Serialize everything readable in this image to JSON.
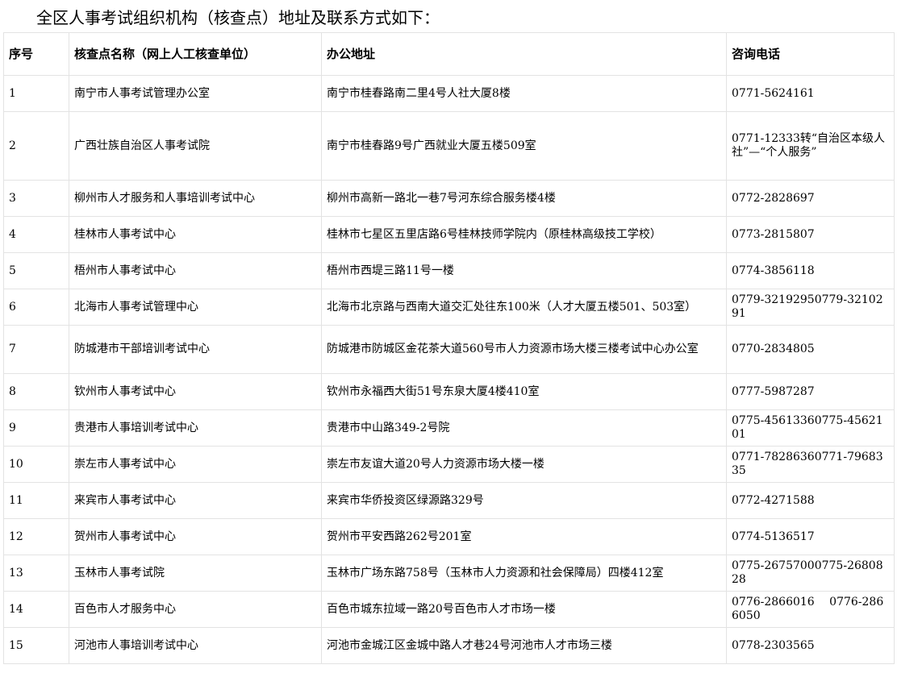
{
  "heading": "全区人事考试组织机构（核查点）地址及联系方式如下：",
  "table": {
    "headers": [
      "序号",
      "核查点名称（网上人工核查单位）",
      "办公地址",
      "咨询电话"
    ],
    "rows": [
      {
        "no": "1",
        "name": "南宁市人事考试管理办公室",
        "address": "南宁市桂春路南二里4号人社大厦8楼",
        "phone": "0771-5624161"
      },
      {
        "no": "2",
        "name": "广西壮族自治区人事考试院",
        "address": "南宁市桂春路9号广西就业大厦五楼509室",
        "phone": "0771-12333转“自治区本级人社”—“个人服务”"
      },
      {
        "no": "3",
        "name": "柳州市人才服务和人事培训考试中心",
        "address": "柳州市高新一路北一巷7号河东综合服务楼4楼",
        "phone": "0772-2828697"
      },
      {
        "no": "4",
        "name": "桂林市人事考试中心",
        "address": "桂林市七星区五里店路6号桂林技师学院内（原桂林高级技工学校）",
        "phone": "0773-2815807"
      },
      {
        "no": "5",
        "name": "梧州市人事考试中心",
        "address": "梧州市西堤三路11号一楼",
        "phone": "0774-3856118"
      },
      {
        "no": "6",
        "name": "北海市人事考试管理中心",
        "address": "北海市北京路与西南大道交汇处往东100米（人才大厦五楼501、503室）",
        "phone": "0779-32192950779-3210291"
      },
      {
        "no": "7",
        "name": "防城港市干部培训考试中心",
        "address": "防城港市防城区金花茶大道560号市人力资源市场大楼三楼考试中心办公室",
        "phone": "0770-2834805"
      },
      {
        "no": "8",
        "name": "钦州市人事考试中心",
        "address": "钦州市永福西大街51号东泉大厦4楼410室",
        "phone": "0777-5987287"
      },
      {
        "no": "9",
        "name": "贵港市人事培训考试中心",
        "address": "贵港市中山路349-2号院",
        "phone": "0775-45613360775-4562101"
      },
      {
        "no": "10",
        "name": "崇左市人事考试中心",
        "address": "崇左市友谊大道20号人力资源市场大楼一楼",
        "phone": "0771-78286360771-7968335"
      },
      {
        "no": "11",
        "name": "来宾市人事考试中心",
        "address": "来宾市华侨投资区绿源路329号",
        "phone": "0772-4271588"
      },
      {
        "no": "12",
        "name": "贺州市人事考试中心",
        "address": "贺州市平安西路262号201室",
        "phone": "0774-5136517"
      },
      {
        "no": "13",
        "name": "玉林市人事考试院",
        "address": "玉林市广场东路758号（玉林市人力资源和社会保障局）四楼412室",
        "phone": "0775-26757000775-2680828"
      },
      {
        "no": "14",
        "name": "百色市人才服务中心",
        "address": "百色市城东拉域一路20号百色市人才市场一楼",
        "phone": "0776-2866016　 0776-2866050"
      },
      {
        "no": "15",
        "name": "河池市人事培训考试中心",
        "address": "河池市金城江区金城中路人才巷24号河池市人才市场三楼",
        "phone": "0778-2303565"
      }
    ]
  }
}
